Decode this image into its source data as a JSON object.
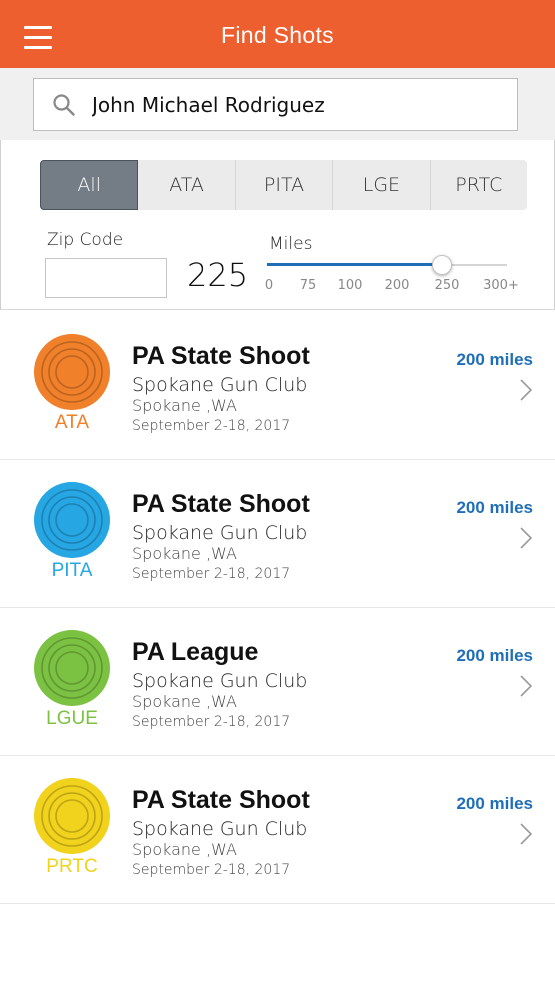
{
  "header": {
    "title": "Find Shots",
    "menu_icon": "hamburger-menu-icon",
    "bg_color": "#ee5f30"
  },
  "search": {
    "icon": "search-icon",
    "value": "John Michael Rodriguez",
    "placeholder": ""
  },
  "filters": {
    "segments": [
      {
        "label": "All",
        "selected": true
      },
      {
        "label": "ATA",
        "selected": false
      },
      {
        "label": "PITA",
        "selected": false
      },
      {
        "label": "LGE",
        "selected": false
      },
      {
        "label": "PRTC",
        "selected": false
      }
    ],
    "zip_label": "Zip Code",
    "zip_value": "",
    "miles_label": "Miles",
    "miles_value": "225",
    "slider": {
      "min": 0,
      "max": 300,
      "value": 225,
      "accent": "#1f6eb8"
    },
    "ticks": [
      "0",
      "75",
      "100",
      "200",
      "250",
      "300+"
    ]
  },
  "results": [
    {
      "logo_label": "ATA",
      "color": "#f0802a",
      "title": "PA State Shoot",
      "club": "Spokane Gun Club",
      "location": "Spokane ,WA",
      "dates": "September 2-18, 2017",
      "distance": "200 miles"
    },
    {
      "logo_label": "PITA",
      "color": "#26a6e3",
      "title": "PA State Shoot",
      "club": "Spokane Gun Club",
      "location": "Spokane ,WA",
      "dates": "September 2-18, 2017",
      "distance": "200 miles"
    },
    {
      "logo_label": "LGUE",
      "color": "#7cc242",
      "title": "PA League",
      "club": "Spokane Gun Club",
      "location": "Spokane ,WA",
      "dates": "September 2-18, 2017",
      "distance": "200 miles"
    },
    {
      "logo_label": "PRTC",
      "color": "#f1d21c",
      "title": "PA State Shoot",
      "club": "Spokane Gun Club",
      "location": "Spokane ,WA",
      "dates": "September 2-18, 2017",
      "distance": "200 miles"
    }
  ]
}
